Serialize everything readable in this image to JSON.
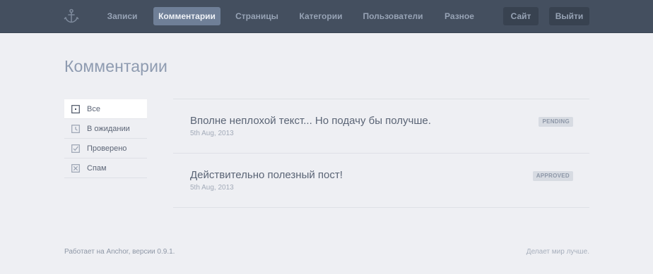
{
  "nav": {
    "items": [
      {
        "label": "Записи",
        "active": false
      },
      {
        "label": "Комментарии",
        "active": true
      },
      {
        "label": "Страницы",
        "active": false
      },
      {
        "label": "Категории",
        "active": false
      },
      {
        "label": "Пользователи",
        "active": false
      },
      {
        "label": "Разное",
        "active": false
      }
    ],
    "site_button": "Сайт",
    "logout_button": "Выйти",
    "logo_icon": "anchor-icon"
  },
  "page": {
    "title": "Комментарии"
  },
  "filters": [
    {
      "label": "Все",
      "icon": "dot-square-icon",
      "active": true
    },
    {
      "label": "В ожидании",
      "icon": "clock-icon",
      "active": false
    },
    {
      "label": "Проверено",
      "icon": "check-icon",
      "active": false
    },
    {
      "label": "Спам",
      "icon": "cross-icon",
      "active": false
    }
  ],
  "comments": [
    {
      "text": "Вполне неплохой текст... Но подачу бы получше.",
      "date": "5th Aug, 2013",
      "status": "PENDING"
    },
    {
      "text": "Действительно полезный пост!",
      "date": "5th Aug, 2013",
      "status": "APPROVED"
    }
  ],
  "footer": {
    "left": "Работает на Anchor, версии 0.9.1.",
    "right": "Делает мир лучше."
  },
  "colors": {
    "topbar": "#444f5f",
    "active_nav": "#6f7f97",
    "background": "#eeeff3"
  }
}
